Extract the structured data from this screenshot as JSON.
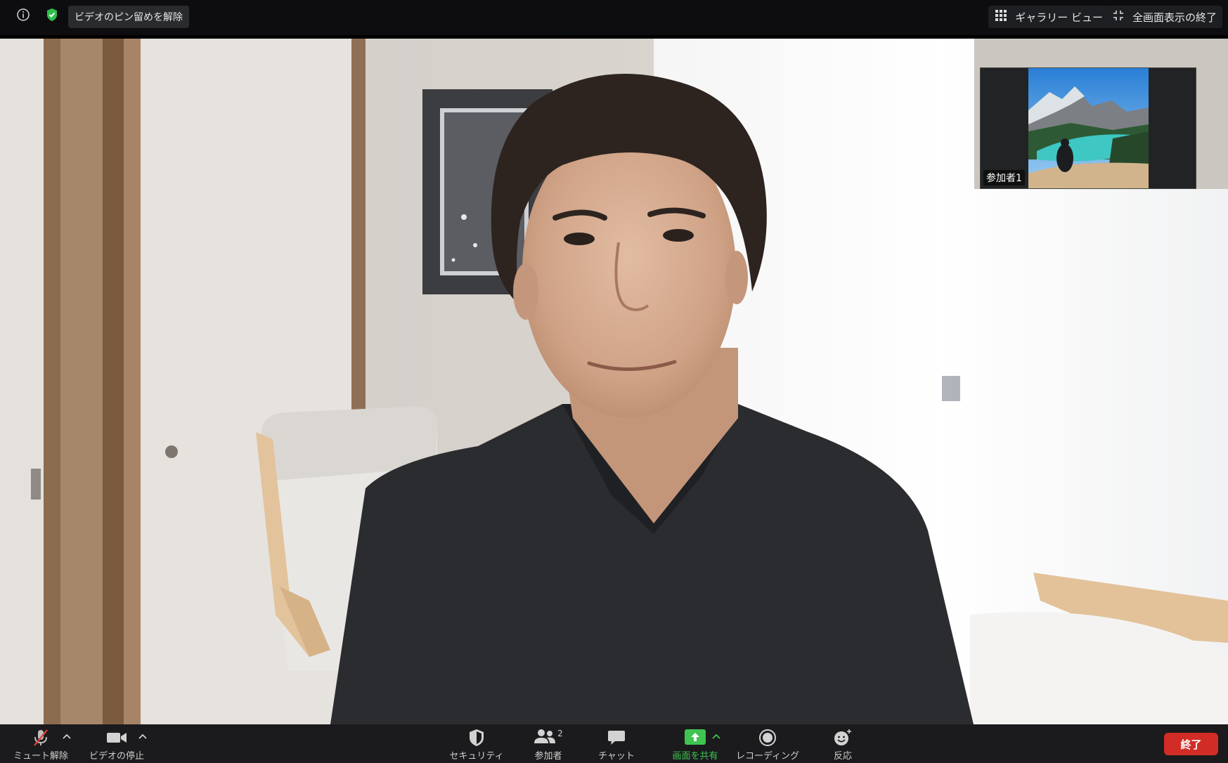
{
  "top_bar": {
    "unpin_label": "ビデオのピン留めを解除",
    "gallery_label": "ギャラリー ビュー",
    "exit_fullscreen_label": "全画面表示の終了"
  },
  "thumbnail": {
    "participant_name": "参加者1"
  },
  "toolbar": {
    "mute_label": "ミュート解除",
    "video_label": "ビデオの停止",
    "security_label": "セキュリティ",
    "participants_label": "参加者",
    "participants_count": "2",
    "chat_label": "チャット",
    "share_label": "画面を共有",
    "record_label": "レコーディング",
    "reactions_label": "反応",
    "end_label": "終了"
  },
  "colors": {
    "share_green": "#3ec451",
    "end_red": "#d12d26",
    "shield_green": "#2fbf4e",
    "toolbar_bg": "#1b1b1d"
  },
  "icons": {
    "info": "info-icon",
    "shield": "encryption-shield-icon",
    "gallery": "gallery-grid-icon",
    "exit_fullscreen": "exit-fullscreen-icon",
    "mute": "microphone-muted-icon",
    "video": "video-camera-icon",
    "security": "security-shield-icon",
    "participants": "participants-icon",
    "chat": "chat-bubble-icon",
    "share": "share-screen-icon",
    "record": "record-icon",
    "reactions": "reaction-emoji-icon"
  }
}
